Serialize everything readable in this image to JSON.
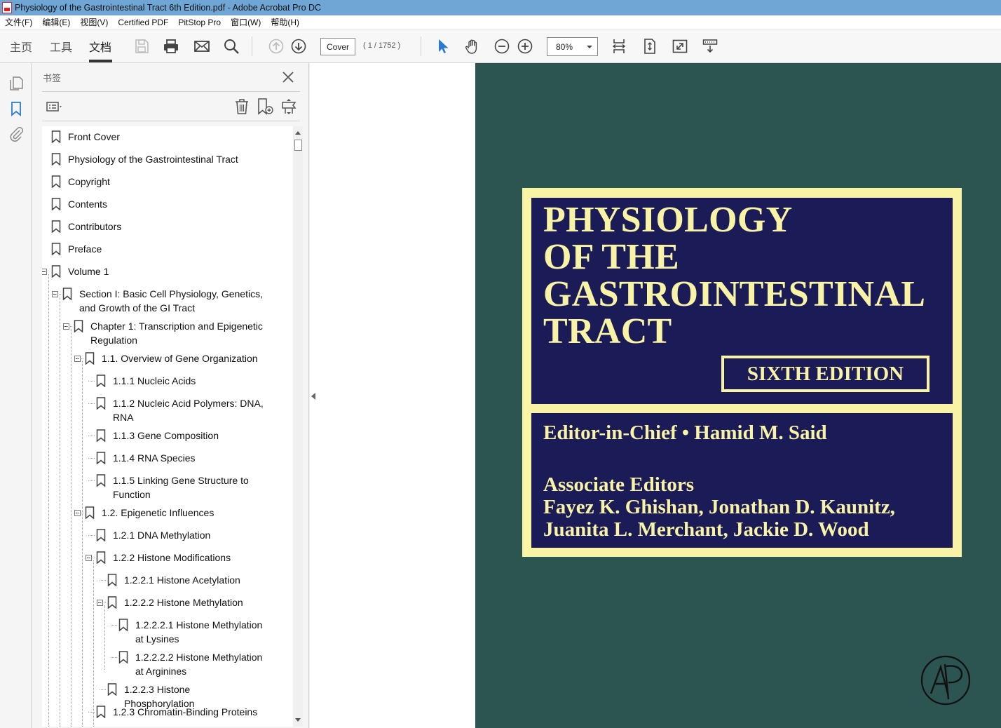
{
  "window": {
    "title": "Physiology of the Gastrointestinal Tract 6th Edition.pdf - Adobe Acrobat Pro DC"
  },
  "menu": [
    "文件(F)",
    "编辑(E)",
    "视图(V)",
    "Certified PDF",
    "PitStop Pro",
    "窗口(W)",
    "帮助(H)"
  ],
  "toolbar": {
    "tabs": {
      "home": "主页",
      "tools": "工具",
      "document": "文档"
    },
    "page_label": "Cover",
    "page_count": "( 1 / 1752 )",
    "zoom": "80%"
  },
  "panel": {
    "title": "书签"
  },
  "bookmarks": [
    "Front Cover",
    "Physiology of the Gastrointestinal Tract",
    "Copyright",
    "Contents",
    "Contributors",
    "Preface",
    "Volume 1",
    "Section I: Basic Cell Physiology, Genetics, and Growth of the GI Tract",
    "Chapter 1: Transcription and Epigenetic Regulation",
    "1.1. Overview of Gene Organization",
    "1.1.1 Nucleic Acids",
    "1.1.2 Nucleic Acid Polymers: DNA, RNA",
    "1.1.3 Gene Composition",
    "1.1.4 RNA Species",
    "1.1.5 Linking Gene Structure to Function",
    "1.2. Epigenetic Influences",
    "1.2.1 DNA Methylation",
    "1.2.2 Histone Modifications",
    "1.2.2.1 Histone Acetylation",
    "1.2.2.2 Histone Methylation",
    "1.2.2.2.1 Histone Methylation at Lysines",
    "1.2.2.2.2 Histone Methylation at Arginines",
    "1.2.2.3 Histone Phosphorylation",
    "1.2.3 Chromatin-Binding Proteins"
  ],
  "cover": {
    "title_lines": [
      "PHYSIOLOGY",
      "OF THE",
      "GASTROINTESTINAL",
      "TRACT"
    ],
    "edition": "SIXTH EDITION",
    "editor_line": "Editor-in-Chief • Hamid M. Said",
    "associate_heading": "Associate Editors",
    "associate_line1": "Fayez K. Ghishan, Jonathan D. Kaunitz,",
    "associate_line2": "Juanita L. Merchant, Jackie D. Wood"
  },
  "colors": {
    "cover_background": "#2c5450",
    "cover_panel": "#1b1b58",
    "cover_text": "#f9f3a6",
    "titlebar": "#6fa6d6",
    "accent_blue": "#2a7bd4"
  }
}
